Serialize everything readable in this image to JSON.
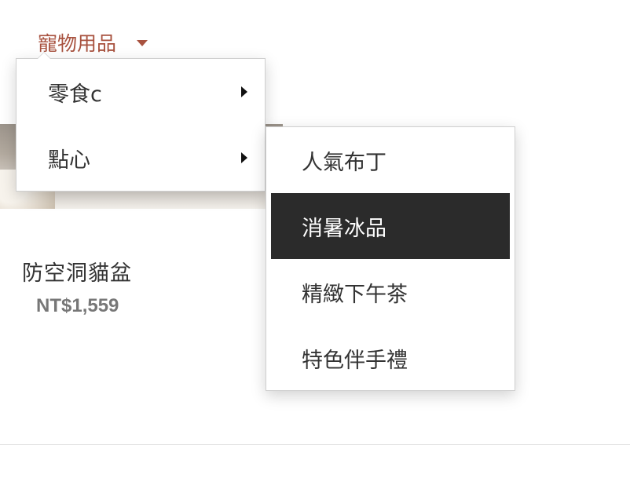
{
  "nav": {
    "trigger_label": "寵物用品",
    "accent_color": "#a8523f"
  },
  "product": {
    "name": "防空洞貓盆",
    "price": "NT$1,559"
  },
  "menu_level1": {
    "items": [
      {
        "label": "零食c",
        "has_submenu": true
      },
      {
        "label": "點心",
        "has_submenu": true
      }
    ]
  },
  "menu_level2": {
    "items": [
      {
        "label": "人氣布丁",
        "active": false
      },
      {
        "label": "消暑冰品",
        "active": true
      },
      {
        "label": "精緻下午茶",
        "active": false
      },
      {
        "label": "特色伴手禮",
        "active": false
      }
    ],
    "active_bg": "#2b2b2b"
  }
}
